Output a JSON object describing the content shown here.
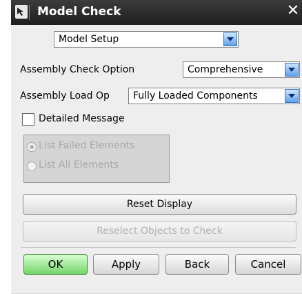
{
  "window": {
    "title": "Model Check"
  },
  "model_setup": {
    "value": "Model Setup"
  },
  "assembly_check_option": {
    "label": "Assembly Check Option",
    "value": "Comprehensive"
  },
  "assembly_load_option": {
    "label": "Assembly Load Op",
    "value": "Fully Loaded Components"
  },
  "detailed_message": {
    "label": "Detailed Message",
    "checked": false
  },
  "list_options": {
    "failed": {
      "label": "List Failed Elements",
      "selected": true
    },
    "all": {
      "label": "List All Elements",
      "selected": false
    }
  },
  "buttons": {
    "reset_display": "Reset Display",
    "reselect_objects": "Reselect Objects to Check",
    "ok": "OK",
    "apply": "Apply",
    "back": "Back",
    "cancel": "Cancel"
  },
  "colors": {
    "titlebar": "#2a2a2a",
    "ok_button": "#73d66a",
    "dropdown_arrow": "#5fa0e8"
  }
}
